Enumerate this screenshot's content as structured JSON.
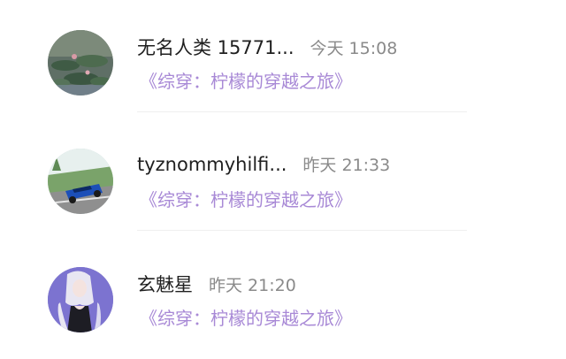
{
  "comments": [
    {
      "user": "无名人类 15771...",
      "time": "今天 15:08",
      "work_title": "《综穿：柠檬的穿越之旅》",
      "avatar_icon": "lotus-pond-avatar-icon"
    },
    {
      "user": "tyznommyhilfi...",
      "time": "昨天 21:33",
      "work_title": "《综穿：柠檬的穿越之旅》",
      "avatar_icon": "blue-sports-car-avatar-icon"
    },
    {
      "user": "玄魅星",
      "time": "昨天 21:20",
      "work_title": "《综穿：柠檬的穿越之旅》",
      "avatar_icon": "anime-girl-avatar-icon"
    }
  ],
  "colors": {
    "name": "#1f1f1f",
    "time": "#8a8a8a",
    "link": "#a889d6",
    "divider": "#efefef"
  }
}
